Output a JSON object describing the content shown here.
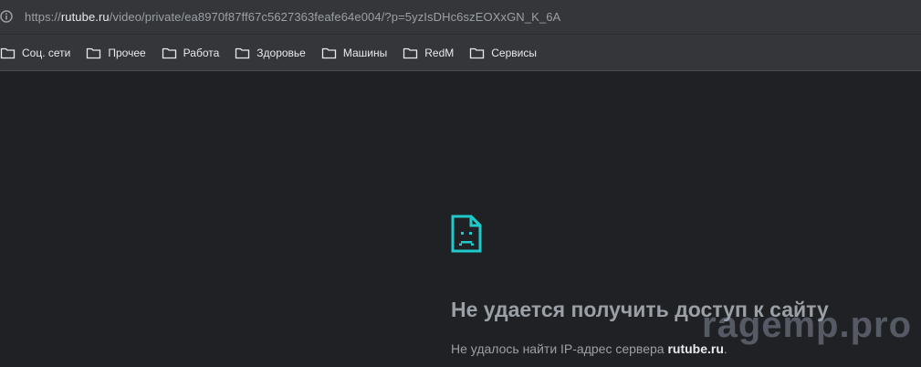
{
  "address_bar": {
    "icon": "info-icon",
    "url_scheme": "https://",
    "url_host": "rutube.ru",
    "url_path": "/video/private/ea8970f87ff67c5627363feafe64e004/?p=5yzIsDHc6szEOXxGN_K_6A"
  },
  "bookmarks": [
    {
      "label": "Соц. сети",
      "icon": "folder-icon"
    },
    {
      "label": "Прочее",
      "icon": "folder-icon"
    },
    {
      "label": "Работа",
      "icon": "folder-icon"
    },
    {
      "label": "Здоровье",
      "icon": "folder-icon"
    },
    {
      "label": "Машины",
      "icon": "folder-icon"
    },
    {
      "label": "RedM",
      "icon": "folder-icon"
    },
    {
      "label": "Сервисы",
      "icon": "folder-icon"
    }
  ],
  "error": {
    "icon": "sad-page-icon",
    "title": "Не удается получить доступ к сайту",
    "detail_prefix": "Не удалось найти IP-адрес сервера ",
    "detail_server": "rutube.ru",
    "detail_suffix": "."
  },
  "watermark": "ragemp.pro",
  "colors": {
    "page_bg": "#202124",
    "toolbar_bg": "#35363a",
    "error_icon": "#1fc9c9",
    "muted_text": "#9aa0a6",
    "bright_text": "#e8eaed"
  }
}
